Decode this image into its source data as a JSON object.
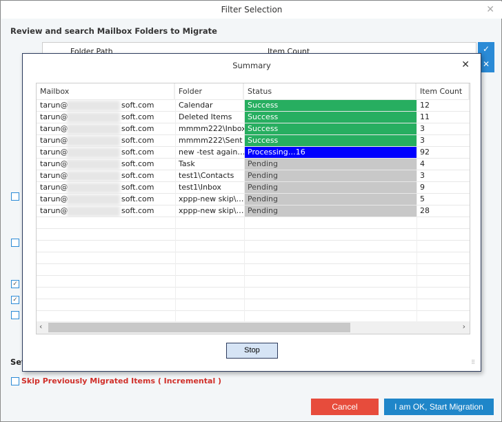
{
  "window": {
    "title": "Filter Selection",
    "heading": "Review and search Mailbox Folders to Migrate",
    "bg_columns": [
      "Folder Path",
      "Item Count"
    ],
    "set_label": "Set",
    "skip_label": "Skip Previously Migrated Items ( Incremental )",
    "cancel": "Cancel",
    "start": "I am OK, Start Migration"
  },
  "summary": {
    "title": "Summary",
    "columns": [
      "Mailbox",
      "Folder",
      "Status",
      "Item Count"
    ],
    "rows": [
      {
        "mailbox_prefix": "tarun@",
        "mailbox_suffix": "soft.com",
        "folder": "Calendar",
        "status": "Success",
        "count": "12"
      },
      {
        "mailbox_prefix": "tarun@",
        "mailbox_suffix": "soft.com",
        "folder": "Deleted Items",
        "status": "Success",
        "count": "11"
      },
      {
        "mailbox_prefix": "tarun@",
        "mailbox_suffix": "soft.com",
        "folder": "mmmm222\\Inbox",
        "status": "Success",
        "count": "3"
      },
      {
        "mailbox_prefix": "tarun@",
        "mailbox_suffix": "soft.com",
        "folder": "mmmm222\\Sent",
        "status": "Success",
        "count": "3"
      },
      {
        "mailbox_prefix": "tarun@",
        "mailbox_suffix": "soft.com",
        "folder": "new -test again…",
        "status": "Processing…16",
        "count": "92"
      },
      {
        "mailbox_prefix": "tarun@",
        "mailbox_suffix": "soft.com",
        "folder": "Task",
        "status": "Pending",
        "count": "4"
      },
      {
        "mailbox_prefix": "tarun@",
        "mailbox_suffix": "soft.com",
        "folder": "test1\\Contacts",
        "status": "Pending",
        "count": "3"
      },
      {
        "mailbox_prefix": "tarun@",
        "mailbox_suffix": "soft.com",
        "folder": "test1\\Inbox",
        "status": "Pending",
        "count": "9"
      },
      {
        "mailbox_prefix": "tarun@",
        "mailbox_suffix": "soft.com",
        "folder": "xppp-new skip\\…",
        "status": "Pending",
        "count": "5"
      },
      {
        "mailbox_prefix": "tarun@",
        "mailbox_suffix": "soft.com",
        "folder": "xppp-new skip\\…",
        "status": "Pending",
        "count": "28"
      }
    ],
    "stop": "Stop"
  },
  "colors": {
    "success": "#27ae60",
    "processing": "#0000ff",
    "pending": "#c8c8c8"
  }
}
